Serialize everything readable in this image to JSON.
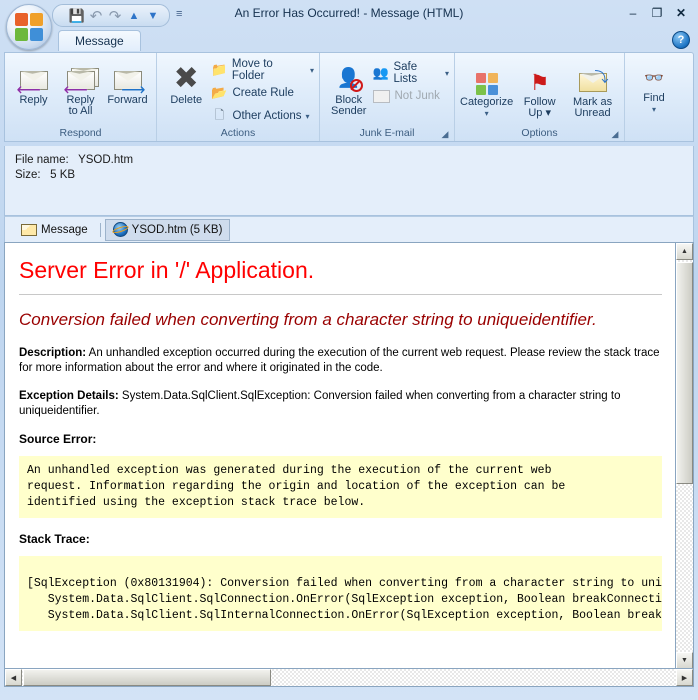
{
  "window": {
    "title": "An Error Has Occurred! - Message (HTML)",
    "minimize": "–",
    "maximize": "❐",
    "close": "✕",
    "help": "?"
  },
  "quick_access": {
    "items": [
      {
        "name": "save-icon",
        "glyph": "💾"
      },
      {
        "name": "undo-icon",
        "glyph": "↶"
      },
      {
        "name": "redo-icon",
        "glyph": "↷"
      },
      {
        "name": "previous-item-icon",
        "glyph": "▲"
      },
      {
        "name": "next-item-icon",
        "glyph": "▼"
      }
    ],
    "customize": "≡"
  },
  "ribbon": {
    "tabs": [
      {
        "label": "Message",
        "selected": true
      }
    ],
    "groups": [
      {
        "label": "Respond",
        "buttons": [
          {
            "label": "Reply",
            "icon": "reply-icon"
          },
          {
            "label": "Reply\nto All",
            "line1": "Reply",
            "line2": "to All",
            "icon": "reply-all-icon"
          },
          {
            "label": "Forward",
            "icon": "forward-icon"
          }
        ]
      },
      {
        "label": "Actions",
        "big": [
          {
            "label": "Delete",
            "icon": "delete-icon"
          }
        ],
        "small": [
          {
            "label": "Move to Folder",
            "icon": "move-to-folder-icon",
            "has_caret": true
          },
          {
            "label": "Create Rule",
            "icon": "create-rule-icon",
            "has_caret": false
          },
          {
            "label": "Other Actions",
            "icon": "other-actions-icon",
            "has_caret": true
          }
        ]
      },
      {
        "label": "Junk E-mail",
        "has_dialog_launcher": true,
        "big": [
          {
            "line1": "Block",
            "line2": "Sender",
            "icon": "block-sender-icon"
          }
        ],
        "small": [
          {
            "label": "Safe Lists",
            "icon": "safe-lists-icon",
            "has_caret": true,
            "disabled": false
          },
          {
            "label": "Not Junk",
            "icon": "not-junk-icon",
            "has_caret": false,
            "disabled": true
          }
        ]
      },
      {
        "label": "Options",
        "has_dialog_launcher": true,
        "buttons": [
          {
            "line1": "Categorize",
            "line2": "▾",
            "icon": "categorize-icon"
          },
          {
            "line1": "Follow",
            "line2": "Up ▾",
            "icon": "follow-up-icon"
          },
          {
            "line1": "Mark as",
            "line2": "Unread",
            "icon": "mark-unread-icon"
          }
        ]
      },
      {
        "label": "",
        "buttons": [
          {
            "line1": "Find",
            "line2": "▾",
            "icon": "find-icon"
          }
        ]
      }
    ]
  },
  "attachment_info": {
    "file_name_label": "File name:",
    "file_name_value": "YSOD.htm",
    "size_label": "Size:",
    "size_value": "5 KB"
  },
  "attachment_tabs": [
    {
      "label": "Message",
      "icon": "message-envelope-icon",
      "selected": false
    },
    {
      "label": "YSOD.htm (5 KB)",
      "icon": "html-document-icon",
      "selected": true
    }
  ],
  "preview": {
    "heading": "Server Error in '/' Application.",
    "subheading": "Conversion failed when converting from a character string to uniqueidentifier.",
    "description_label": "Description:",
    "description_text": " An unhandled exception occurred during the execution of the current web request. Please review the stack trace for more information about the error and where it originated in the code.",
    "exception_label": "Exception Details:",
    "exception_text": " System.Data.SqlClient.SqlException: Conversion failed when converting from a character string to uniqueidentifier.",
    "source_error_label": "Source Error:",
    "source_error_code": "An unhandled exception was generated during the execution of the current web\nrequest. Information regarding the origin and location of the exception can be\nidentified using the exception stack trace below.",
    "stack_trace_label": "Stack Trace:",
    "stack_trace_code": "[SqlException (0x80131904): Conversion failed when converting from a character string to uni\n   System.Data.SqlClient.SqlConnection.OnError(SqlException exception, Boolean breakConnecti\n   System.Data.SqlClient.SqlInternalConnection.OnError(SqlException exception, Boolean break"
  },
  "scrollbars": {
    "up_arrow": "▲",
    "down_arrow": "▼",
    "left_arrow": "◀",
    "right_arrow": "▶"
  },
  "colors": {
    "error_heading": "#ff0000",
    "error_subheading": "#990000",
    "code_background": "#ffffcc",
    "ribbon_label": "#3c5d80"
  }
}
